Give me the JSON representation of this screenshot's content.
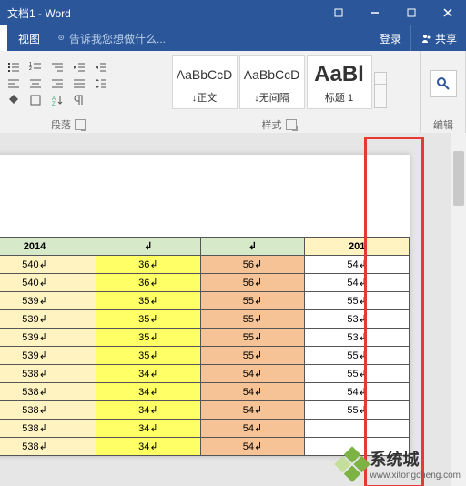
{
  "window": {
    "title": "文档1 - Word"
  },
  "tabs": {
    "view": "视图",
    "tell": "告诉我您想做什么...",
    "login": "登录",
    "share": "共享"
  },
  "ribbon": {
    "para_label": "段落",
    "styles_label": "样式",
    "edit_label": "编辑",
    "styles": [
      {
        "preview": "AaBbCcD",
        "name": "↓正文"
      },
      {
        "preview": "AaBbCcD",
        "name": "↓无间隔"
      },
      {
        "preview": "AaBl",
        "name": "标题 1"
      }
    ]
  },
  "table": {
    "headers": [
      "2014",
      "",
      "",
      "201"
    ],
    "rows": [
      [
        "540",
        "36",
        "56",
        "54"
      ],
      [
        "540",
        "36",
        "56",
        "54"
      ],
      [
        "539",
        "35",
        "55",
        "55"
      ],
      [
        "539",
        "35",
        "55",
        "53"
      ],
      [
        "539",
        "35",
        "55",
        "53"
      ],
      [
        "539",
        "35",
        "55",
        "55"
      ],
      [
        "538",
        "34",
        "54",
        "55"
      ],
      [
        "538",
        "34",
        "54",
        "54"
      ],
      [
        "538",
        "34",
        "54",
        "55"
      ],
      [
        "538",
        "34",
        "54",
        ""
      ],
      [
        "538",
        "34",
        "54",
        ""
      ]
    ]
  },
  "watermark": {
    "brand": "系统城",
    "url": "www.xitongcheng.com"
  }
}
